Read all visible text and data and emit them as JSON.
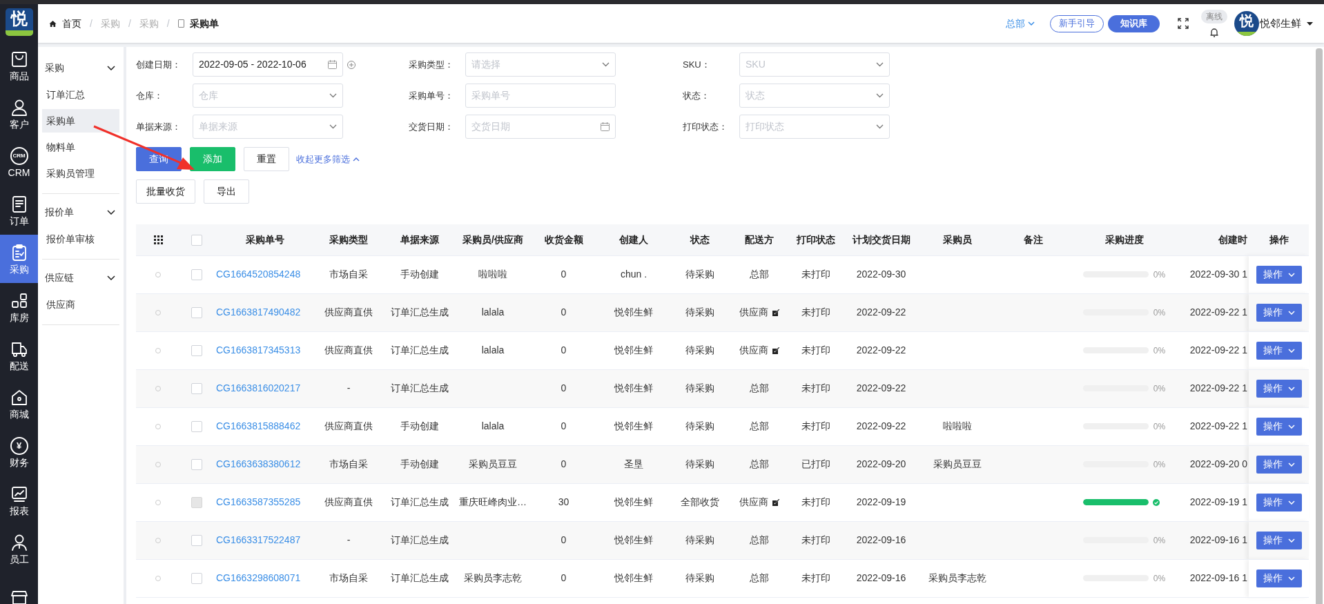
{
  "logo": {
    "text": "悦"
  },
  "rail": [
    {
      "label": "商品",
      "kind": "bag",
      "selected": false
    },
    {
      "label": "客户",
      "kind": "user",
      "selected": false
    },
    {
      "label": "CRM",
      "kind": "crm",
      "icon_text": "CRM",
      "selected": false
    },
    {
      "label": "订单",
      "kind": "doc",
      "selected": false
    },
    {
      "label": "采购",
      "kind": "clipboard",
      "selected": true
    },
    {
      "label": "库房",
      "kind": "blocks",
      "selected": false
    },
    {
      "label": "配送",
      "kind": "truck",
      "selected": false
    },
    {
      "label": "商城",
      "kind": "house",
      "selected": false
    },
    {
      "label": "财务",
      "kind": "coin",
      "icon_text": "¥",
      "selected": false
    },
    {
      "label": "报表",
      "kind": "chart",
      "selected": false
    },
    {
      "label": "员工",
      "kind": "person",
      "selected": false
    },
    {
      "kind": "store",
      "selected": false
    }
  ],
  "breadcrumb": [
    {
      "label": "首页",
      "kind": "home"
    },
    {
      "label": "采购",
      "kind": "link"
    },
    {
      "label": "采购",
      "kind": "link"
    },
    {
      "label": "采购单",
      "kind": "current"
    }
  ],
  "breadcrumb_separator": "/",
  "header": {
    "org": "总部",
    "guide_button": "新手引导",
    "kb_button": "知识库",
    "offline_badge": "离线",
    "avatar_text": "悦",
    "user": "悦邻生鲜"
  },
  "submenu": [
    {
      "label": "采购",
      "expanded": true,
      "children": [
        {
          "label": "订单汇总",
          "selected": false
        },
        {
          "label": "采购单",
          "selected": true
        },
        {
          "label": "物料单",
          "selected": false
        },
        {
          "label": "采购员管理",
          "selected": false
        }
      ]
    },
    {
      "label": "报价单",
      "expanded": true,
      "children": [
        {
          "label": "报价单审核",
          "selected": false
        }
      ]
    },
    {
      "label": "供应链",
      "expanded": true,
      "children": [
        {
          "label": "供应商",
          "selected": false
        }
      ]
    }
  ],
  "filters": [
    {
      "label": "创建日期：",
      "kind": "daterange",
      "value": "2022-09-05 - 2022-10-06"
    },
    {
      "label": "采购类型：",
      "kind": "select",
      "placeholder": "请选择"
    },
    {
      "label": "SKU：",
      "kind": "select",
      "placeholder": "SKU"
    },
    {
      "label": "仓库：",
      "kind": "select",
      "placeholder": "仓库"
    },
    {
      "label": "采购单号：",
      "kind": "text",
      "placeholder": "采购单号"
    },
    {
      "label": "状态：",
      "kind": "select",
      "placeholder": "状态"
    },
    {
      "label": "单据来源：",
      "kind": "select",
      "placeholder": "单据来源"
    },
    {
      "label": "交货日期：",
      "kind": "date",
      "placeholder": "交货日期"
    },
    {
      "label": "打印状态：",
      "kind": "select",
      "placeholder": "打印状态"
    }
  ],
  "actions": [
    {
      "label": "查询",
      "kind": "primary"
    },
    {
      "label": "添加",
      "kind": "success"
    },
    {
      "label": "重置",
      "kind": "default"
    }
  ],
  "collapse_link": "收起更多筛选",
  "actions2": [
    "批量收货",
    "导出"
  ],
  "table": {
    "header_checked": false,
    "columns": [
      "采购单号",
      "采购类型",
      "单据来源",
      "采购员/供应商",
      "收货金额",
      "创建人",
      "状态",
      "配送方",
      "打印状态",
      "计划交货日期",
      "采购员",
      "备注",
      "采购进度",
      "创建时",
      "操作"
    ],
    "rows": [
      {
        "no": "CG1664520854248",
        "type": "市场自采",
        "source": "手动创建",
        "supplier": "啦啦啦",
        "amount": "0",
        "creator": "chun .",
        "status": "待采购",
        "delivery": "总部",
        "delivery_edit": false,
        "print": "未打印",
        "date": "2022-09-30",
        "progress": {
          "level": 0,
          "label": "0%"
        },
        "created": "2022-09-30 1",
        "action": "操作",
        "checked": false,
        "disabled": false
      },
      {
        "no": "CG1663817490482",
        "type": "供应商直供",
        "source": "订单汇总生成",
        "supplier": "lalala",
        "amount": "0",
        "creator": "悦邻生鲜",
        "status": "待采购",
        "delivery": "供应商",
        "delivery_edit": true,
        "print": "未打印",
        "date": "2022-09-22",
        "progress": {
          "level": 0,
          "label": "0%"
        },
        "created": "2022-09-22 1",
        "action": "操作",
        "checked": false,
        "disabled": false
      },
      {
        "no": "CG1663817345313",
        "type": "供应商直供",
        "source": "订单汇总生成",
        "supplier": "lalala",
        "amount": "0",
        "creator": "悦邻生鲜",
        "status": "待采购",
        "delivery": "供应商",
        "delivery_edit": true,
        "print": "未打印",
        "date": "2022-09-22",
        "progress": {
          "level": 0,
          "label": "0%"
        },
        "created": "2022-09-22 1",
        "action": "操作",
        "checked": false,
        "disabled": false
      },
      {
        "no": "CG1663816020217",
        "type": "-",
        "source": "订单汇总生成",
        "amount": "0",
        "creator": "悦邻生鲜",
        "status": "待采购",
        "delivery": "总部",
        "delivery_edit": false,
        "print": "未打印",
        "date": "2022-09-22",
        "progress": {
          "level": 0,
          "label": "0%"
        },
        "created": "2022-09-22 1",
        "action": "操作",
        "checked": false,
        "disabled": false
      },
      {
        "no": "CG1663815888462",
        "type": "供应商直供",
        "source": "手动创建",
        "supplier": "lalala",
        "amount": "0",
        "creator": "悦邻生鲜",
        "status": "待采购",
        "delivery": "总部",
        "delivery_edit": false,
        "print": "未打印",
        "date": "2022-09-22",
        "buyer": "啦啦啦",
        "progress": {
          "level": 0,
          "label": "0%"
        },
        "created": "2022-09-22 1",
        "action": "操作",
        "checked": false,
        "disabled": false
      },
      {
        "no": "CG1663638380612",
        "type": "市场自采",
        "source": "手动创建",
        "supplier": "采购员豆豆",
        "amount": "0",
        "creator": "圣垦",
        "status": "待采购",
        "delivery": "总部",
        "delivery_edit": false,
        "print": "已打印",
        "date": "2022-09-20",
        "buyer": "采购员豆豆",
        "progress": {
          "level": 0,
          "label": "0%"
        },
        "created": "2022-09-20 0",
        "action": "操作",
        "checked": false,
        "disabled": false
      },
      {
        "no": "CG1663587355285",
        "type": "供应商直供",
        "source": "订单汇总生成",
        "supplier": "重庆旺峰肉业…",
        "amount": "30",
        "creator": "悦邻生鲜",
        "status": "全部收货",
        "delivery": "供应商",
        "delivery_edit": true,
        "print": "未打印",
        "date": "2022-09-19",
        "progress": {
          "level": 1
        },
        "created": "2022-09-19 1",
        "action": "操作",
        "checked": false,
        "disabled": true
      },
      {
        "no": "CG1663317522487",
        "type": "-",
        "source": "订单汇总生成",
        "amount": "0",
        "creator": "悦邻生鲜",
        "status": "待采购",
        "delivery": "总部",
        "delivery_edit": false,
        "print": "未打印",
        "date": "2022-09-16",
        "progress": {
          "level": 0,
          "label": "0%"
        },
        "created": "2022-09-16 1",
        "action": "操作",
        "checked": false,
        "disabled": false
      },
      {
        "no": "CG1663298608071",
        "type": "市场自采",
        "source": "订单汇总生成",
        "supplier": "采购员李志乾",
        "amount": "0",
        "creator": "悦邻生鲜",
        "status": "待采购",
        "delivery": "总部",
        "delivery_edit": false,
        "print": "未打印",
        "date": "2022-09-16",
        "buyer": "采购员李志乾",
        "progress": {
          "level": 0,
          "label": "0%"
        },
        "created": "2022-09-16 1",
        "action": "操作",
        "checked": false,
        "disabled": false
      }
    ]
  }
}
